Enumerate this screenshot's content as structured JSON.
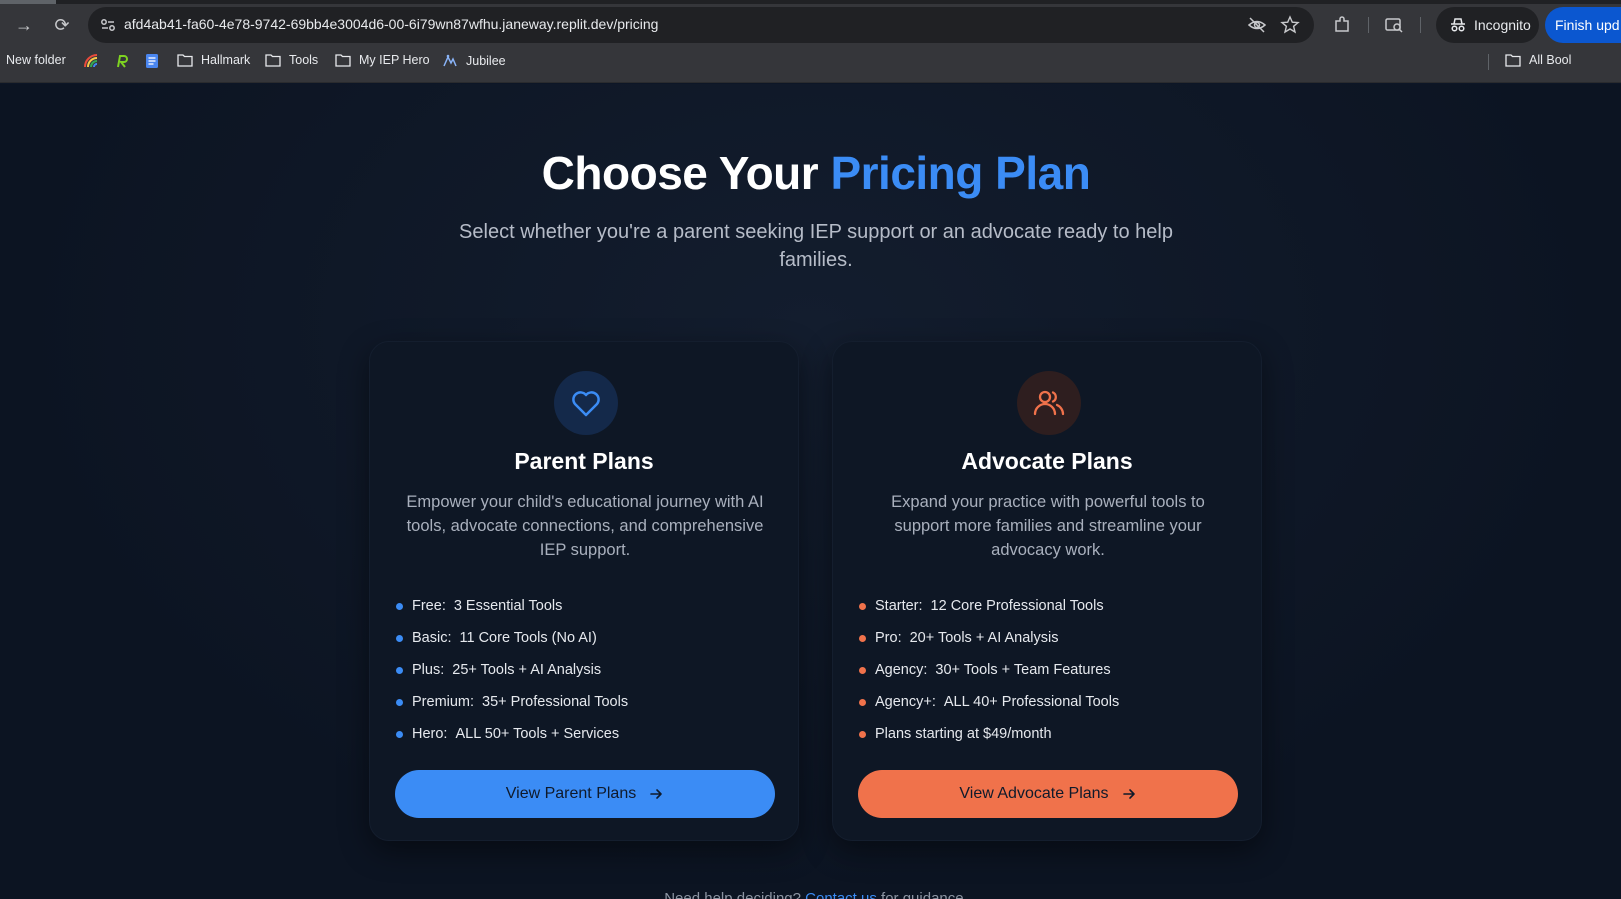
{
  "browser": {
    "url": "afd4ab41-fa60-4e78-9742-69bb4e3004d6-00-6i79wn87wfhu.janeway.replit.dev/pricing",
    "incognito_label": "Incognito",
    "finish_update_label": "Finish upd",
    "bookmarks": [
      {
        "label": "New folder",
        "icon": "none"
      },
      {
        "label": "",
        "icon": "rainbow-app-icon"
      },
      {
        "label": "",
        "icon": "r-logo-icon"
      },
      {
        "label": "",
        "icon": "docs-icon"
      },
      {
        "label": "Hallmark",
        "icon": "folder-icon"
      },
      {
        "label": "Tools",
        "icon": "folder-icon"
      },
      {
        "label": "My IEP Hero",
        "icon": "folder-icon"
      },
      {
        "label": "Jubilee",
        "icon": "jubilee-icon"
      }
    ],
    "all_bookmarks_label": "All Bool"
  },
  "hero": {
    "title_prefix": "Choose Your ",
    "title_highlight": "Pricing Plan",
    "subtitle": "Select whether you're a parent seeking IEP support or an advocate ready to help families."
  },
  "parent_card": {
    "icon": "heart-icon",
    "title": "Parent Plans",
    "description": "Empower your child's educational journey with AI tools, advocate connections, and comprehensive IEP support.",
    "features": [
      {
        "key": "Free:",
        "value": "3 Essential Tools"
      },
      {
        "key": "Basic:",
        "value": "11 Core Tools (No AI)"
      },
      {
        "key": "Plus:",
        "value": "25+ Tools + AI Analysis"
      },
      {
        "key": "Premium:",
        "value": "35+ Professional Tools"
      },
      {
        "key": "Hero:",
        "value": "ALL 50+ Tools + Services"
      }
    ],
    "cta": "View Parent Plans"
  },
  "advocate_card": {
    "icon": "users-icon",
    "title": "Advocate Plans",
    "description": "Expand your practice with powerful tools to support more families and streamline your advocacy work.",
    "features": [
      {
        "key": "Starter:",
        "value": "12 Core Professional Tools"
      },
      {
        "key": "Pro:",
        "value": "20+ Tools + AI Analysis"
      },
      {
        "key": "Agency:",
        "value": "30+ Tools + Team Features"
      },
      {
        "key": "Agency+:",
        "value": "ALL 40+ Professional Tools"
      },
      {
        "key": "",
        "value": "Plans starting at $49/month"
      }
    ],
    "cta": "View Advocate Plans"
  },
  "footer": {
    "prefix": "Need help deciding? ",
    "link": "Contact us",
    "suffix": " for guidance."
  },
  "colors": {
    "accent_blue": "#3b8cf5",
    "accent_orange": "#f0724b",
    "background": "#0d1626"
  }
}
